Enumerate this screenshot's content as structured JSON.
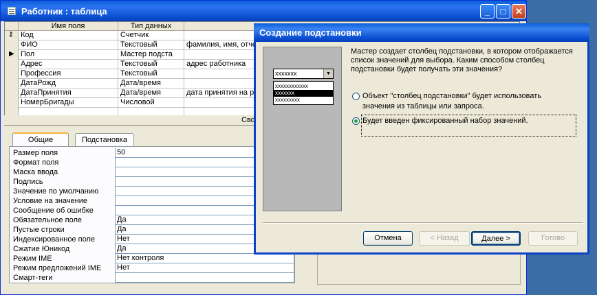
{
  "table_window": {
    "title": "Работник : таблица",
    "controls": {
      "minimize": "_",
      "maximize": "□",
      "close": "✕"
    },
    "grid": {
      "columns": [
        "Имя поля",
        "Тип данных"
      ],
      "rows": [
        {
          "name": "Код",
          "type": "Счетчик",
          "desc": "",
          "key": true
        },
        {
          "name": "ФИО",
          "type": "Текстовый",
          "desc": "фамилия, имя, отче"
        },
        {
          "name": "Пол",
          "type": "Мастер подста",
          "desc": "",
          "current": true
        },
        {
          "name": "Адрес",
          "type": "Текстовый",
          "desc": "адрес работника"
        },
        {
          "name": "Профессия",
          "type": "Текстовый",
          "desc": ""
        },
        {
          "name": "ДатаРожд",
          "type": "Дата/время",
          "desc": ""
        },
        {
          "name": "ДатаПринятия",
          "type": "Дата/время",
          "desc": "дата принятия на р"
        },
        {
          "name": "НомерБригады",
          "type": "Числовой",
          "desc": ""
        }
      ],
      "footer_label": "Сво"
    },
    "tabs": [
      "Общие",
      "Подстановка"
    ],
    "properties": [
      {
        "label": "Размер поля",
        "value": "50"
      },
      {
        "label": "Формат поля",
        "value": ""
      },
      {
        "label": "Маска ввода",
        "value": ""
      },
      {
        "label": "Подпись",
        "value": ""
      },
      {
        "label": "Значение по умолчанию",
        "value": ""
      },
      {
        "label": "Условие на значение",
        "value": ""
      },
      {
        "label": "Сообщение об ошибке",
        "value": ""
      },
      {
        "label": "Обязательное поле",
        "value": "Да"
      },
      {
        "label": "Пустые строки",
        "value": "Да"
      },
      {
        "label": "Индексированное поле",
        "value": "Нет"
      },
      {
        "label": "Сжатие Юникод",
        "value": "Да"
      },
      {
        "label": "Режим IME",
        "value": "Нет контроля"
      },
      {
        "label": "Режим предложений IME",
        "value": "Нет"
      },
      {
        "label": "Смарт-теги",
        "value": ""
      }
    ]
  },
  "dialog": {
    "title": "Создание подстановки",
    "preview": {
      "combo_text": "xxxxxxx",
      "list_items": [
        "xxxxxxxxxxxx",
        "xxxxxxx",
        "xxxxxxxxx"
      ]
    },
    "description": "Мастер создает столбец подстановки, в котором отображается список значений для выбора.  Каким способом столбец подстановки будет получать эти значения?",
    "options": [
      {
        "label_line1": "Объект \"столбец подстановки\" будет использовать",
        "label_line2": "значения из таблицы или запроса.",
        "selected": false
      },
      {
        "label_line1": "Будет введен фиксированный набор значений.",
        "selected": true
      }
    ],
    "buttons": {
      "cancel": "Отмена",
      "back": "< Назад",
      "next": "Далее >",
      "finish": "Готово"
    }
  }
}
